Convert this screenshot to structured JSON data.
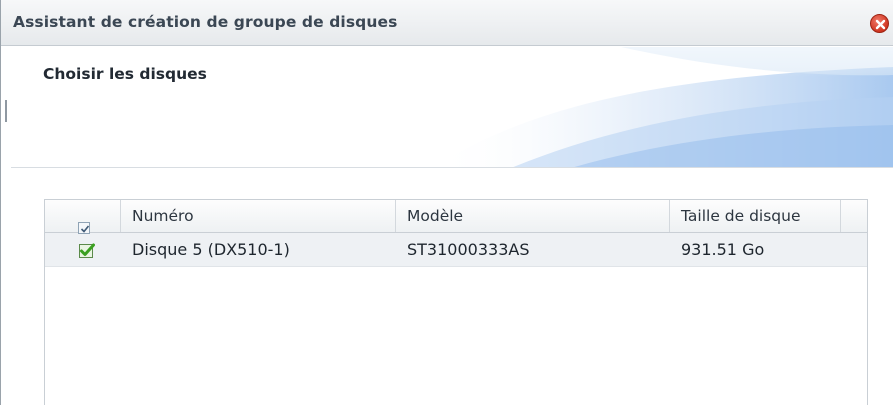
{
  "window": {
    "title": "Assistant de création de groupe de disques"
  },
  "banner": {
    "title": "Choisir les disques"
  },
  "table": {
    "columns": [
      "Numéro",
      "Modèle",
      "Taille de disque"
    ],
    "header_checkbox_checked": true,
    "rows": [
      {
        "checked": true,
        "numero": "Disque 5 (DX510-1)",
        "modele": "ST31000333AS",
        "taille": "931.51 Go"
      }
    ]
  },
  "colors": {
    "titlebar": "#e9ecef",
    "close": "#d03520",
    "banner_accent": "#7fb0e8",
    "row_selected": "#eef1f4",
    "check_green": "#3aa020"
  },
  "icons": {
    "close": "close-icon",
    "header_checkbox": "checkbox-icon",
    "row_check": "green-check-icon"
  }
}
